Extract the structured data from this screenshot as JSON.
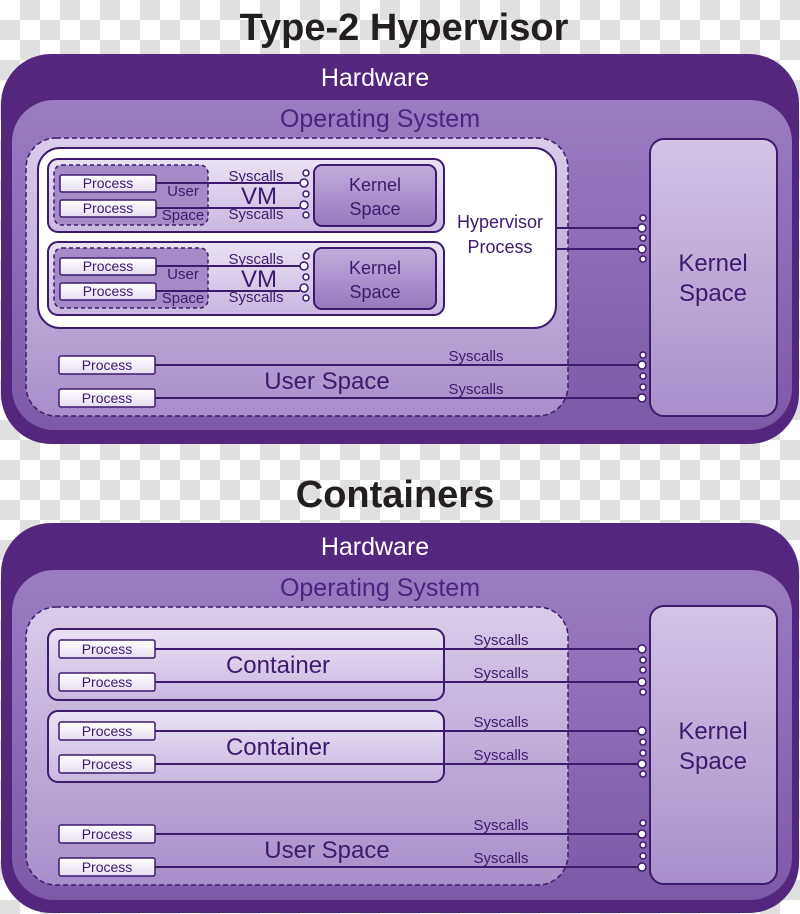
{
  "colors": {
    "hardware": "#54277f",
    "os": "#8a6bb4",
    "kernel": "#c5b3dc",
    "text_dark": "#3d1a6e",
    "hypervisor_bg": "#ffffff"
  },
  "hypervisor_diagram": {
    "title": "Type-2 Hypervisor",
    "hardware_label": "Hardware",
    "os_label": "Operating System",
    "hypervisor_label_line1": "Hypervisor",
    "hypervisor_label_line2": "Process",
    "kernel_line1": "Kernel",
    "kernel_line2": "Space",
    "user_space_label": "User Space",
    "vms": [
      {
        "label": "VM",
        "user_line1": "User",
        "user_line2": "Space",
        "kernel_line1": "Kernel",
        "kernel_line2": "Space",
        "processes": [
          "Process",
          "Process"
        ],
        "syscalls": [
          "Syscalls",
          "Syscalls"
        ]
      },
      {
        "label": "VM",
        "user_line1": "User",
        "user_line2": "Space",
        "kernel_line1": "Kernel",
        "kernel_line2": "Space",
        "processes": [
          "Process",
          "Process"
        ],
        "syscalls": [
          "Syscalls",
          "Syscalls"
        ]
      }
    ],
    "host_processes": [
      "Process",
      "Process"
    ],
    "host_syscalls": [
      "Syscalls",
      "Syscalls"
    ]
  },
  "containers_diagram": {
    "title": "Containers",
    "hardware_label": "Hardware",
    "os_label": "Operating System",
    "kernel_line1": "Kernel",
    "kernel_line2": "Space",
    "user_space_label": "User Space",
    "containers": [
      {
        "label": "Container",
        "processes": [
          "Process",
          "Process"
        ],
        "syscalls": [
          "Syscalls",
          "Syscalls"
        ]
      },
      {
        "label": "Container",
        "processes": [
          "Process",
          "Process"
        ],
        "syscalls": [
          "Syscalls",
          "Syscalls"
        ]
      }
    ],
    "host_processes": [
      "Process",
      "Process"
    ],
    "host_syscalls": [
      "Syscalls",
      "Syscalls"
    ]
  }
}
